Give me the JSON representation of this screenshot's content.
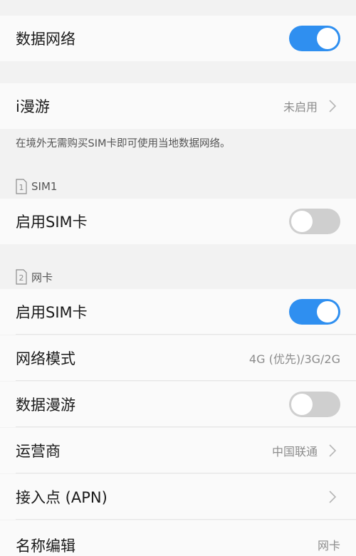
{
  "mobile_data": {
    "label": "数据网络",
    "enabled": true
  },
  "iroaming": {
    "label": "i漫游",
    "status": "未启用",
    "note": "在境外无需购买SIM卡即可使用当地数据网络。"
  },
  "sim1": {
    "header": "SIM1",
    "slot_number": "1",
    "enable_label": "启用SIM卡",
    "enabled": false
  },
  "sim2": {
    "header": "网卡",
    "slot_number": "2",
    "enable_label": "启用SIM卡",
    "enabled": true,
    "network_mode_label": "网络模式",
    "network_mode_value": "4G (优先)/3G/2G",
    "data_roaming_label": "数据漫游",
    "data_roaming_enabled": false,
    "carrier_label": "运营商",
    "carrier_value": "中国联通",
    "apn_label": "接入点 (APN)",
    "name_edit_label": "名称编辑",
    "name_edit_value": "网卡"
  },
  "colors": {
    "toggle_on": "#2f8ff0",
    "toggle_off": "#cfcfcf",
    "background": "#f2f2f2",
    "row_background": "#fafafa"
  }
}
